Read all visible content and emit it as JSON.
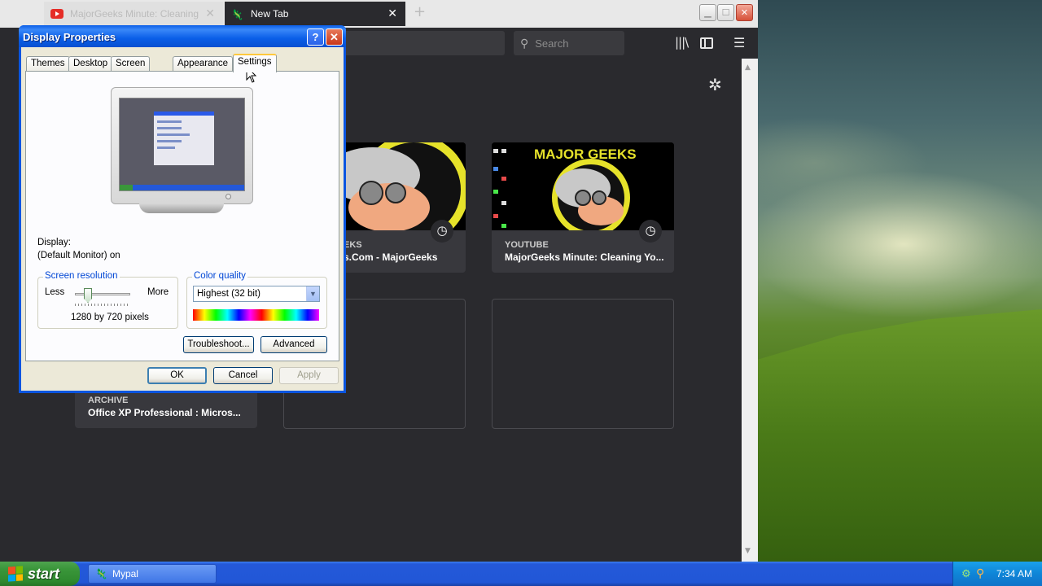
{
  "browser": {
    "tabs": [
      {
        "title": "MajorGeeks Minute: Cleaning",
        "icon": "youtube-icon"
      },
      {
        "title": "New Tab",
        "icon": "mypal-icon"
      }
    ],
    "search_placeholder": "Search",
    "top_sites": [
      {
        "site": "EKS",
        "title": "s.Com - MajorGeeks"
      },
      {
        "site": "YOUTUBE",
        "title": "MajorGeeks Minute: Cleaning Yo..."
      },
      {
        "site": "ARCHIVE",
        "title": "Office XP Professional : Micros..."
      }
    ]
  },
  "dialog": {
    "title": "Display Properties",
    "help": "?",
    "tabs": [
      "Themes",
      "Desktop",
      "Screen Saver",
      "Appearance",
      "Settings"
    ],
    "active_tab": "Settings",
    "display_label": "Display:",
    "display_value": "(Default Monitor) on",
    "screen_resolution": {
      "legend": "Screen resolution",
      "less": "Less",
      "more": "More",
      "value": "1280 by 720 pixels"
    },
    "color_quality": {
      "legend": "Color quality",
      "selected": "Highest (32 bit)"
    },
    "buttons": {
      "troubleshoot": "Troubleshoot...",
      "advanced": "Advanced",
      "ok": "OK",
      "cancel": "Cancel",
      "apply": "Apply"
    }
  },
  "taskbar": {
    "start": "start",
    "task": "Mypal",
    "clock": "7:34 AM"
  },
  "colors": {
    "xp_title_blue": "#0a5ee8",
    "dialog_face": "#ece9d8",
    "browser_dark": "#2a2a2e",
    "taskbar_blue": "#2458d8",
    "start_green": "#3a963a"
  }
}
